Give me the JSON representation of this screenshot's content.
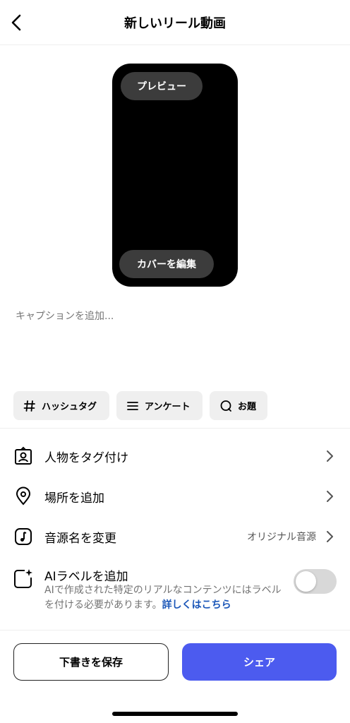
{
  "header": {
    "title": "新しいリール動画",
    "back_icon": "chevron-left-icon"
  },
  "preview": {
    "preview_label": "プレビュー",
    "cover_label": "カバーを編集",
    "background": "#000000"
  },
  "caption": {
    "placeholder": "キャプションを追加..."
  },
  "chips": [
    {
      "icon": "hashtag-icon",
      "label": "ハッシュタグ"
    },
    {
      "icon": "poll-lines-icon",
      "label": "アンケート"
    },
    {
      "icon": "topic-bubble-icon",
      "label": "お題"
    }
  ],
  "rows": [
    {
      "icon": "tag-people-icon",
      "label": "人物をタグ付け",
      "value": ""
    },
    {
      "icon": "location-pin-icon",
      "label": "場所を追加",
      "value": ""
    },
    {
      "icon": "music-icon",
      "label": "音源名を変更",
      "value": "オリジナル音源"
    }
  ],
  "ai_label": {
    "icon": "ai-sparkle-icon",
    "label": "AIラベルを追加",
    "desc": "AIで作成された特定のリアルなコンテンツにはラベルを付ける必要があります。",
    "link": "詳しくはこちら",
    "toggle_on": false
  },
  "footer": {
    "save_label": "下書きを保存",
    "share_label": "シェア",
    "accent": "#4c5bef"
  }
}
